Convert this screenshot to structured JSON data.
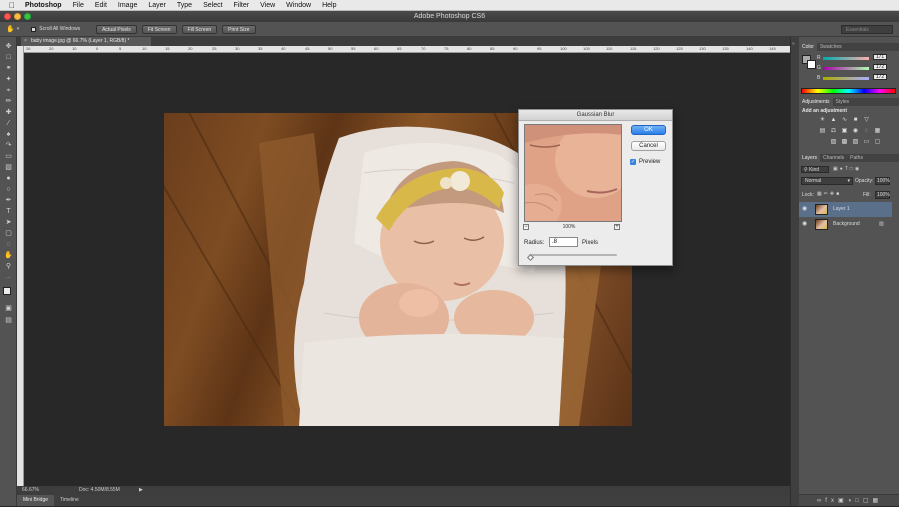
{
  "menubar": {
    "app_name": "Photoshop",
    "items": [
      "File",
      "Edit",
      "Image",
      "Layer",
      "Type",
      "Select",
      "Filter",
      "View",
      "Window",
      "Help"
    ]
  },
  "window": {
    "title": "Adobe Photoshop CS6"
  },
  "options_bar": {
    "scroll_all_windows": "Scroll All Windows",
    "actual_pixels": "Actual Pixels",
    "fit_screen": "Fit Screen",
    "fill_screen": "Fill Screen",
    "print_size": "Print Size",
    "workspace": "Essentials"
  },
  "document": {
    "tab_title": "baby image.jpg @ 66.7% (Layer 1, RGB/8) *",
    "ruler_ticks": [
      "26",
      "20",
      "10",
      "0",
      "5",
      "10",
      "15",
      "20",
      "25",
      "30",
      "35",
      "40",
      "45",
      "50",
      "55",
      "60",
      "65",
      "70",
      "75",
      "80",
      "85",
      "90",
      "95",
      "100",
      "105",
      "110",
      "115",
      "120",
      "125",
      "130",
      "135",
      "140",
      "145"
    ]
  },
  "status": {
    "zoom": "66.67%",
    "doc_info": "Doc: 4.50M/8.55M"
  },
  "bottom_tabs": {
    "mini_bridge": "Mini Bridge",
    "timeline": "Timeline"
  },
  "color_panel": {
    "tabs": [
      "Color",
      "Swatches"
    ],
    "r": "171",
    "g": "172",
    "b": "172"
  },
  "adjustments_panel": {
    "tabs": [
      "Adjustments",
      "Styles"
    ],
    "heading": "Add an adjustment"
  },
  "layers_panel": {
    "tabs": [
      "Layers",
      "Channels",
      "Paths"
    ],
    "kind": "Kind",
    "blend_mode": "Normal",
    "opacity_label": "Opacity:",
    "opacity_value": "100%",
    "lock_label": "Lock:",
    "fill_label": "Fill:",
    "fill_value": "100%",
    "layers": [
      {
        "name": "Layer 1"
      },
      {
        "name": "Background"
      }
    ]
  },
  "gaussian_blur": {
    "title": "Gaussian Blur",
    "ok": "OK",
    "cancel": "Cancel",
    "preview_label": "Preview",
    "preview_checked": true,
    "zoom": "100%",
    "radius_label": "Radius:",
    "radius_value": ".8",
    "units": "Pixels",
    "radius_fraction": 0.008
  },
  "colors": {
    "accent": "#3a84e0",
    "canvas_bg": "#282828",
    "panel_bg": "#535353"
  }
}
